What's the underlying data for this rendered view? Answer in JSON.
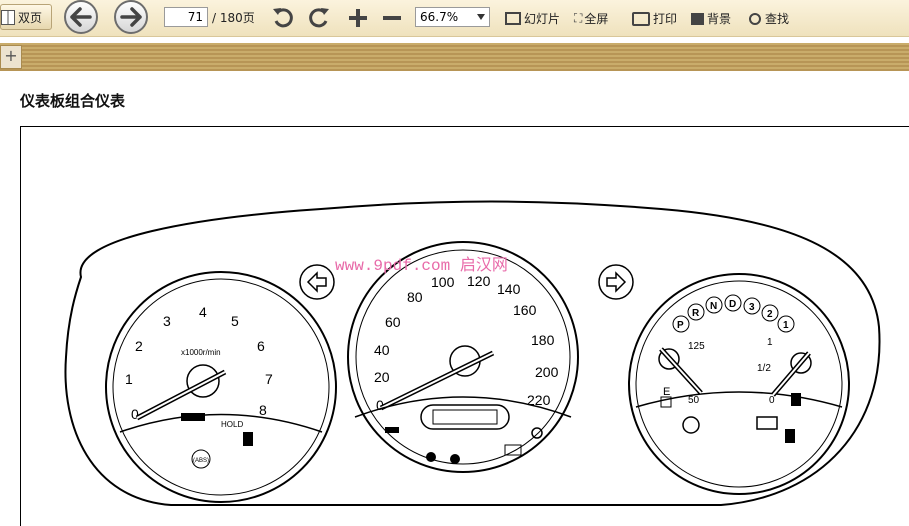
{
  "toolbar": {
    "dual_page_label": "双页",
    "current_page": "71",
    "total_pages": "/ 180页",
    "zoom_value": "66.7%",
    "slideshow_label": "幻灯片",
    "fullscreen_label": "全屏",
    "print_label": "打印",
    "background_label": "背景",
    "find_label": "查找"
  },
  "tabs": {
    "add_label": "+"
  },
  "document": {
    "title": "仪表板组合仪表",
    "watermark": "www.9",
    "watermark_rest": "pdf.com 启汉网",
    "tacho": {
      "ticks": [
        "0",
        "1",
        "2",
        "3",
        "4",
        "5",
        "6",
        "7",
        "8"
      ],
      "unit": "x1000r/min",
      "hold": "HOLD",
      "abs": "(ABS)"
    },
    "speedo": {
      "ticks": [
        "0",
        "20",
        "40",
        "60",
        "80",
        "100",
        "120",
        "140",
        "160",
        "180",
        "200",
        "220"
      ]
    },
    "right_gauges": {
      "gears": [
        "P",
        "R",
        "N",
        "D",
        "3",
        "2",
        "1"
      ],
      "temp_high": "125",
      "temp_mid": "50",
      "temp_low": "E",
      "fuel_full": "1",
      "fuel_half": "1/2",
      "fuel_empty": "0"
    }
  }
}
